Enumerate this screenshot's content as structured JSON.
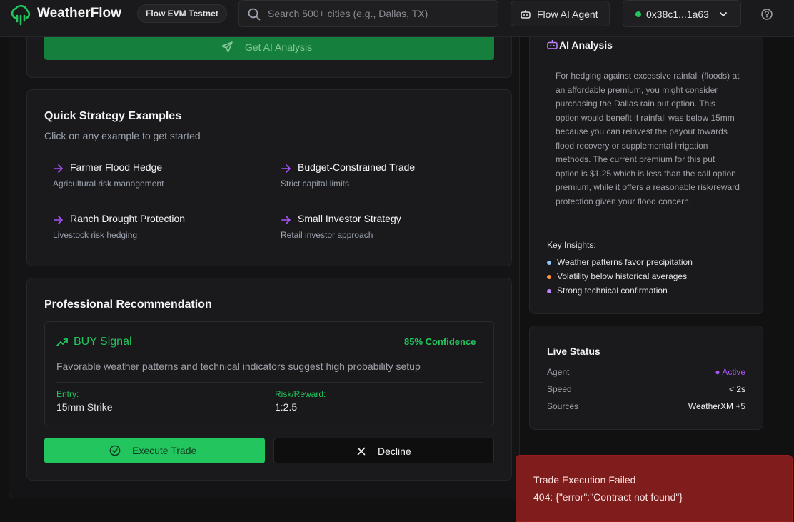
{
  "header": {
    "brand": "WeatherFlow",
    "network_badge": "Flow EVM Testnet",
    "search_placeholder": "Search 500+ cities (e.g., Dallas, TX)",
    "agent_label": "Flow AI Agent",
    "wallet_address": "0x38c1...1a63"
  },
  "analysis_form": {
    "button_label": "Get AI Analysis"
  },
  "quick_strategies": {
    "title": "Quick Strategy Examples",
    "subtitle": "Click on any example to get started",
    "examples": [
      {
        "title": "Farmer Flood Hedge",
        "desc": "Agricultural risk management"
      },
      {
        "title": "Budget-Constrained Trade",
        "desc": "Strict capital limits"
      },
      {
        "title": "Ranch Drought Protection",
        "desc": "Livestock risk hedging"
      },
      {
        "title": "Small Investor Strategy",
        "desc": "Retail investor approach"
      }
    ]
  },
  "recommendation": {
    "title": "Professional Recommendation",
    "signal": "BUY Signal",
    "confidence": "85% Confidence",
    "description": "Favorable weather patterns and technical indicators suggest high probability setup",
    "entry_label": "Entry:",
    "entry_value": "15mm Strike",
    "risk_label": "Risk/Reward:",
    "risk_value": "1:2.5",
    "execute_label": "Execute Trade",
    "decline_label": "Decline"
  },
  "ai_analysis": {
    "title": "AI Analysis",
    "text": "For hedging against excessive rainfall (floods) at an affordable premium, you might consider purchasing the Dallas rain put option. This option would benefit if rainfall was below 15mm because you can reinvest the payout towards flood recovery or supplemental irrigation methods. The current premium for this put option is $1.25 which is less than the call option premium, while it offers a reasonable risk/reward protection given your flood concern.",
    "insights_title": "Key Insights:",
    "insights": [
      {
        "text": "Weather patterns favor precipitation",
        "color": "#93c5fd"
      },
      {
        "text": "Volatility below historical averages",
        "color": "#fb923c"
      },
      {
        "text": "Strong technical confirmation",
        "color": "#c084fc"
      }
    ]
  },
  "live_status": {
    "title": "Live Status",
    "rows": [
      {
        "label": "Agent",
        "value": "Active"
      },
      {
        "label": "Speed",
        "value": "< 2s"
      },
      {
        "label": "Sources",
        "value": "WeatherXM +5"
      }
    ]
  },
  "toast": {
    "title": "Trade Execution Failed",
    "message": "404: {\"error\":\"Contract not found\"}"
  },
  "colors": {
    "accent_green": "#22c55e",
    "accent_purple": "#a855f7",
    "error_red": "#7f1d1d"
  }
}
